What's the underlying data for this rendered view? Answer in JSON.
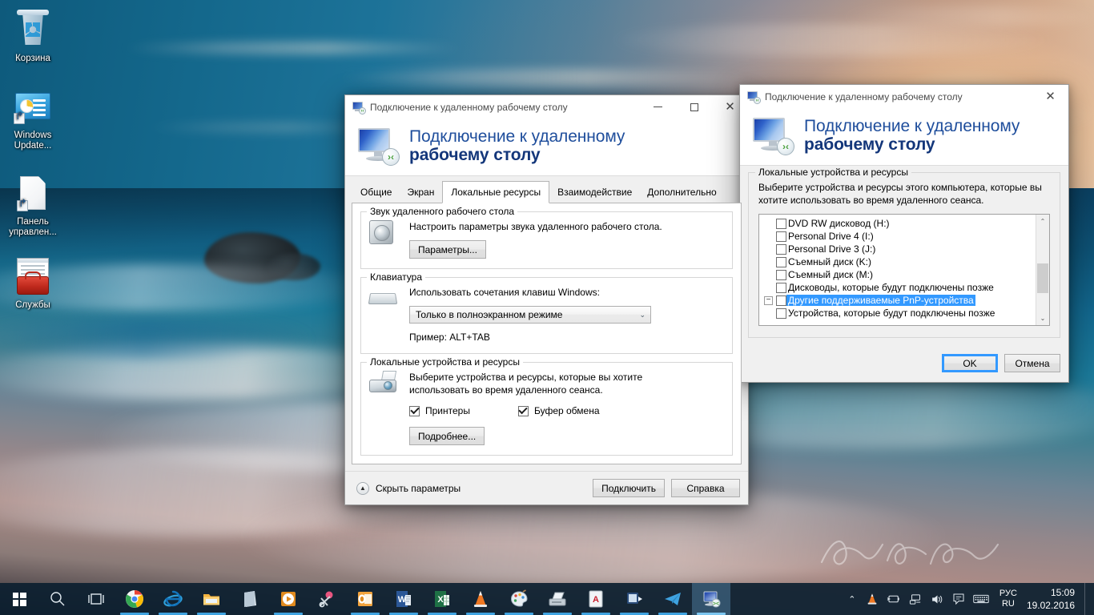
{
  "desktop": {
    "icons": [
      {
        "name": "recycle-bin",
        "label": "Корзина"
      },
      {
        "name": "windows-update",
        "label": "Windows Update..."
      },
      {
        "name": "control-panel",
        "label": "Панель управлен..."
      },
      {
        "name": "services",
        "label": "Службы"
      }
    ]
  },
  "main_window": {
    "title": "Подключение к удаленному рабочему столу",
    "banner_line1": "Подключение к удаленному",
    "banner_line2": "рабочему столу",
    "window_buttons": {
      "minimize": "minimize-icon",
      "maximize": "maximize-icon",
      "close": "close-icon"
    },
    "tabs": [
      {
        "label": "Общие",
        "active": false
      },
      {
        "label": "Экран",
        "active": false
      },
      {
        "label": "Локальные ресурсы",
        "active": true
      },
      {
        "label": "Взаимодействие",
        "active": false
      },
      {
        "label": "Дополнительно",
        "active": false
      }
    ],
    "group_audio": {
      "legend": "Звук удаленного рабочего стола",
      "description": "Настроить параметры звука удаленного рабочего стола.",
      "button": "Параметры..."
    },
    "group_keyboard": {
      "legend": "Клавиатура",
      "description": "Использовать сочетания клавиш Windows:",
      "combo_value": "Только в полноэкранном режиме",
      "combo_chevron": "⌄",
      "example": "Пример: ALT+TAB"
    },
    "group_devices": {
      "legend": "Локальные устройства и ресурсы",
      "description_line1": "Выберите устройства и ресурсы, которые вы хотите",
      "description_line2": "использовать во время удаленного сеанса.",
      "checkbox_printers": {
        "label": "Принтеры",
        "checked": true
      },
      "checkbox_clipboard": {
        "label": "Буфер обмена",
        "checked": true
      },
      "button": "Подробнее..."
    },
    "footer": {
      "collapse_label": "Скрыть параметры",
      "collapse_chevron": "▲",
      "connect_button": "Подключить",
      "help_button": "Справка"
    }
  },
  "modal_window": {
    "title": "Подключение к удаленному рабочему столу",
    "banner_line1": "Подключение к удаленному",
    "banner_line2": "рабочему столу",
    "close_icon": "close-icon",
    "group": {
      "legend": "Локальные устройства и ресурсы",
      "description_line1": "Выберите устройства и ресурсы этого компьютера, которые вы",
      "description_line2": "хотите использовать во время удаленного сеанса."
    },
    "device_list": [
      {
        "label": "DVD RW дисковод (H:)",
        "checked": false,
        "selected": false,
        "expander": null,
        "indent": 1
      },
      {
        "label": "Personal Drive 4 (I:)",
        "checked": false,
        "selected": false,
        "expander": null,
        "indent": 1
      },
      {
        "label": "Personal Drive 3 (J:)",
        "checked": false,
        "selected": false,
        "expander": null,
        "indent": 1
      },
      {
        "label": "Съемный диск (K:)",
        "checked": false,
        "selected": false,
        "expander": null,
        "indent": 1
      },
      {
        "label": "Съемный диск (M:)",
        "checked": false,
        "selected": false,
        "expander": null,
        "indent": 1
      },
      {
        "label": "Дисководы, которые будут подключены позже",
        "checked": false,
        "selected": false,
        "expander": null,
        "indent": 1
      },
      {
        "label": "Другие поддерживаемые PnP-устройства",
        "checked": false,
        "selected": true,
        "expander": "−",
        "indent": 0
      },
      {
        "label": "Устройства, которые будут подключены позже",
        "checked": false,
        "selected": false,
        "expander": null,
        "indent": 1
      }
    ],
    "scroll": {
      "up_arrow": "⌃",
      "down_arrow": "⌄"
    },
    "footer": {
      "ok_button": "OK",
      "cancel_button": "Отмена"
    }
  },
  "taskbar": {
    "start": "windows-start-icon",
    "search": "search-icon",
    "taskview": "task-view-icon",
    "apps": [
      {
        "name": "google-chrome",
        "running": true,
        "active": false
      },
      {
        "name": "internet-explorer",
        "running": true,
        "active": false
      },
      {
        "name": "file-explorer",
        "running": true,
        "active": false
      },
      {
        "name": "store",
        "running": false,
        "active": false
      },
      {
        "name": "media-player",
        "running": true,
        "active": false
      },
      {
        "name": "snipping-tool",
        "running": false,
        "active": false
      },
      {
        "name": "outlook",
        "running": true,
        "active": false
      },
      {
        "name": "word",
        "running": true,
        "active": false
      },
      {
        "name": "excel",
        "running": true,
        "active": false
      },
      {
        "name": "vlc",
        "running": true,
        "active": false
      },
      {
        "name": "paint",
        "running": true,
        "active": false
      },
      {
        "name": "scanner",
        "running": true,
        "active": false
      },
      {
        "name": "adobe-reader",
        "running": true,
        "active": false
      },
      {
        "name": "teamviewer",
        "running": true,
        "active": false
      },
      {
        "name": "telegram",
        "running": true,
        "active": false
      },
      {
        "name": "remote-desktop",
        "running": true,
        "active": true
      }
    ],
    "tray": {
      "overflow": "⌃",
      "icons": [
        "vlc-tray-icon",
        "battery-icon",
        "network-icon",
        "volume-icon",
        "action-center-icon",
        "keyboard-icon"
      ],
      "language_line1": "РУС",
      "language_line2": "RU",
      "time": "15:09",
      "date": "19.02.2016"
    }
  },
  "colors": {
    "accent_blue": "#3399ff",
    "banner_blue": "#1f4e9c",
    "banner_bold_blue": "#13367a",
    "taskbar": "#0c2030",
    "selection": "#3399ff"
  }
}
